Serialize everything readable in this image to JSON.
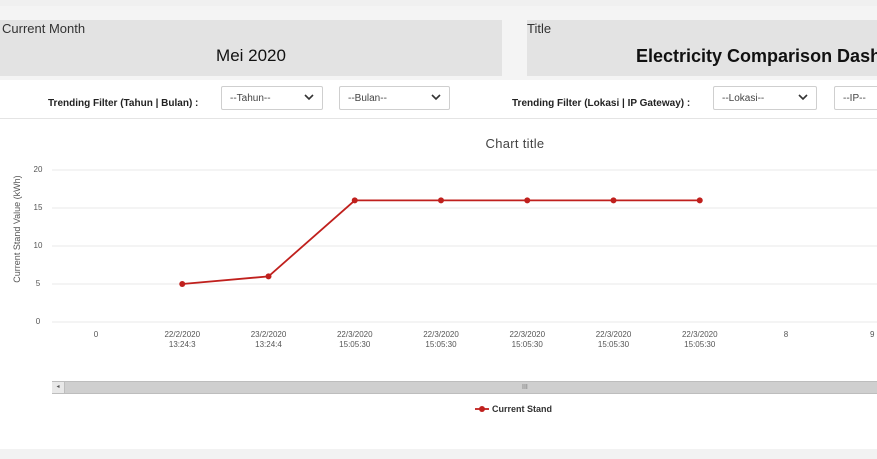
{
  "header": {
    "current_month_label": "Current Month",
    "current_month_value": "Mei 2020",
    "title_label": "Title",
    "title_value": "Electricity Comparison Dash"
  },
  "filters": {
    "trend_year_month_label": "Trending Filter (Tahun | Bulan) :",
    "year_select": "--Tahun--",
    "month_select": "--Bulan--",
    "trend_location_label": "Trending Filter (Lokasi | IP Gateway) :",
    "location_select": "--Lokasi--",
    "ip_select": "--IP--"
  },
  "colors": {
    "series": "#c0201d",
    "gridline": "#e8e8e8",
    "card_bg": "#e3e3e3"
  },
  "scrollbar": {
    "grip": "III",
    "left_arrow": "◂"
  },
  "chart_data": {
    "type": "line",
    "title": "Chart title",
    "xlabel": "",
    "ylabel": "Current Stand Value (kWh)",
    "ylim": [
      0,
      20
    ],
    "yticks": [
      "0",
      "5",
      "10",
      "15",
      "20"
    ],
    "x_tick_labels": [
      [
        "0",
        ""
      ],
      [
        "22/2/2020",
        "13:24:3"
      ],
      [
        "23/2/2020",
        "13:24:4"
      ],
      [
        "22/3/2020",
        "15:05:30"
      ],
      [
        "22/3/2020",
        "15:05:30"
      ],
      [
        "22/3/2020",
        "15:05:30"
      ],
      [
        "22/3/2020",
        "15:05:30"
      ],
      [
        "22/3/2020",
        "15:05:30"
      ],
      [
        "8",
        ""
      ],
      [
        "9",
        ""
      ]
    ],
    "grid": true,
    "legend": "bottom-center",
    "series": [
      {
        "name": "Current Stand",
        "x_index": [
          1,
          2,
          3,
          4,
          5,
          6,
          7
        ],
        "values": [
          5,
          6,
          16,
          16,
          16,
          16,
          16
        ]
      }
    ]
  }
}
